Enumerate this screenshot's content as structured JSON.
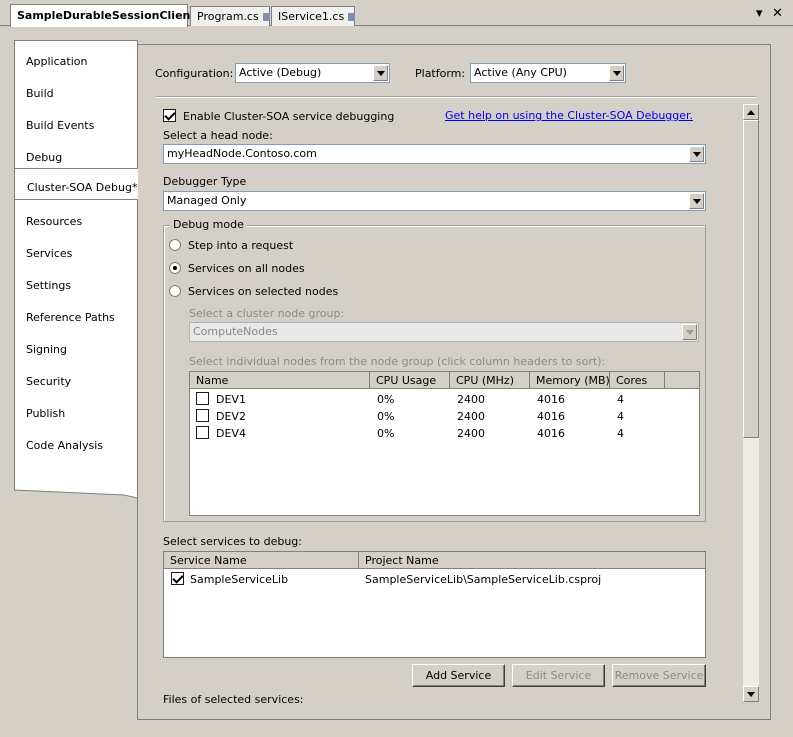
{
  "tabs": [
    {
      "label": "SampleDurableSessionClient*",
      "active": true,
      "locked": false
    },
    {
      "label": "Program.cs",
      "active": false,
      "locked": true
    },
    {
      "label": "IService1.cs",
      "active": false,
      "locked": true
    }
  ],
  "window_buttons": {
    "dropdown": "▾",
    "close": "✕"
  },
  "nav": {
    "items": [
      "Application",
      "Build",
      "Build Events",
      "Debug",
      "Cluster-SOA Debug*",
      "Resources",
      "Services",
      "Settings",
      "Reference Paths",
      "Signing",
      "Security",
      "Publish",
      "Code Analysis"
    ],
    "active_index": 4
  },
  "config": {
    "configuration_label": "Configuration:",
    "configuration_value": "Active (Debug)",
    "platform_label": "Platform:",
    "platform_value": "Active (Any CPU)"
  },
  "debug": {
    "enable_label": "Enable Cluster-SOA service debugging",
    "enable_checked": true,
    "help_link": "Get help on using the Cluster-SOA Debugger.",
    "headnode_label": "Select a head node:",
    "headnode_value": "myHeadNode.Contoso.com",
    "debugger_type_label": "Debugger Type",
    "debugger_type_value": "Managed Only"
  },
  "debug_mode": {
    "title": "Debug mode",
    "options": [
      "Step into a request",
      "Services on all nodes",
      "Services on selected nodes"
    ],
    "selected_index": 1,
    "node_group_label": "Select a cluster node group:",
    "node_group_value": "ComputeNodes",
    "nodes_label": "Select individual nodes from the node group (click column headers to sort):",
    "columns": [
      "Name",
      "CPU Usage",
      "CPU (MHz)",
      "Memory (MB)",
      "Cores"
    ],
    "rows": [
      {
        "name": "DEV1",
        "cpu_usage": "0%",
        "cpu_mhz": "2400",
        "memory": "4016",
        "cores": "4"
      },
      {
        "name": "DEV2",
        "cpu_usage": "0%",
        "cpu_mhz": "2400",
        "memory": "4016",
        "cores": "4"
      },
      {
        "name": "DEV4",
        "cpu_usage": "0%",
        "cpu_mhz": "2400",
        "memory": "4016",
        "cores": "4"
      }
    ]
  },
  "services": {
    "label": "Select services to debug:",
    "columns": [
      "Service Name",
      "Project Name"
    ],
    "rows": [
      {
        "service": "SampleServiceLib",
        "project": "SampleServiceLib\\SampleServiceLib.csproj",
        "checked": true
      }
    ],
    "buttons": {
      "add": "Add Service",
      "edit": "Edit Service",
      "remove": "Remove Service"
    },
    "files_label": "Files of selected services:"
  }
}
